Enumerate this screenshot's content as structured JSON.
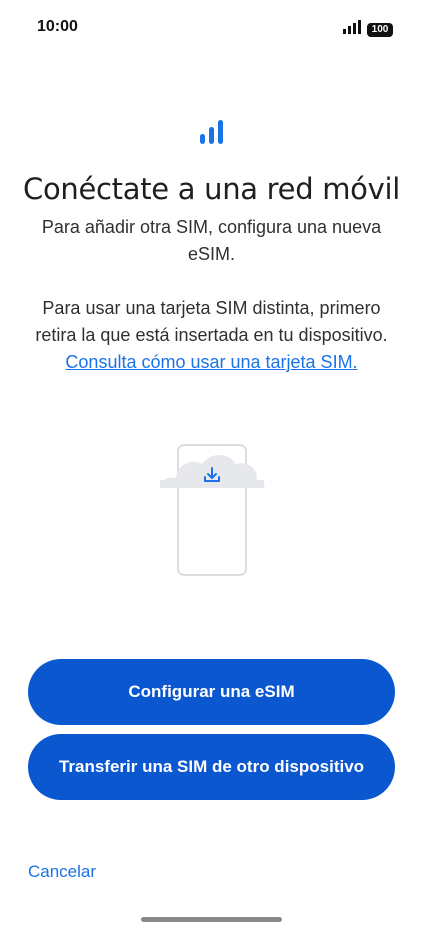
{
  "status_bar": {
    "time": "10:00",
    "battery": "100",
    "signal_icon": "cellular-signal-icon"
  },
  "header": {
    "icon": "signal-bars-icon",
    "accent_color": "#1a73e8"
  },
  "title": "Conéctate a una red móvil",
  "subtitle": "Para añadir otra SIM, configura una nueva eSIM.",
  "body": {
    "text": "Para usar una tarjeta SIM distinta, primero retira la que está insertada en tu dispositivo.",
    "link": "Consulta cómo usar una tarjeta SIM."
  },
  "illustration": {
    "icon": "phone-cloud-download-icon"
  },
  "buttons": {
    "configure": "Configurar una eSIM",
    "transfer": "Transferir una SIM de otro dispositivo",
    "color": "#0b57d0"
  },
  "cancel": "Cancelar"
}
